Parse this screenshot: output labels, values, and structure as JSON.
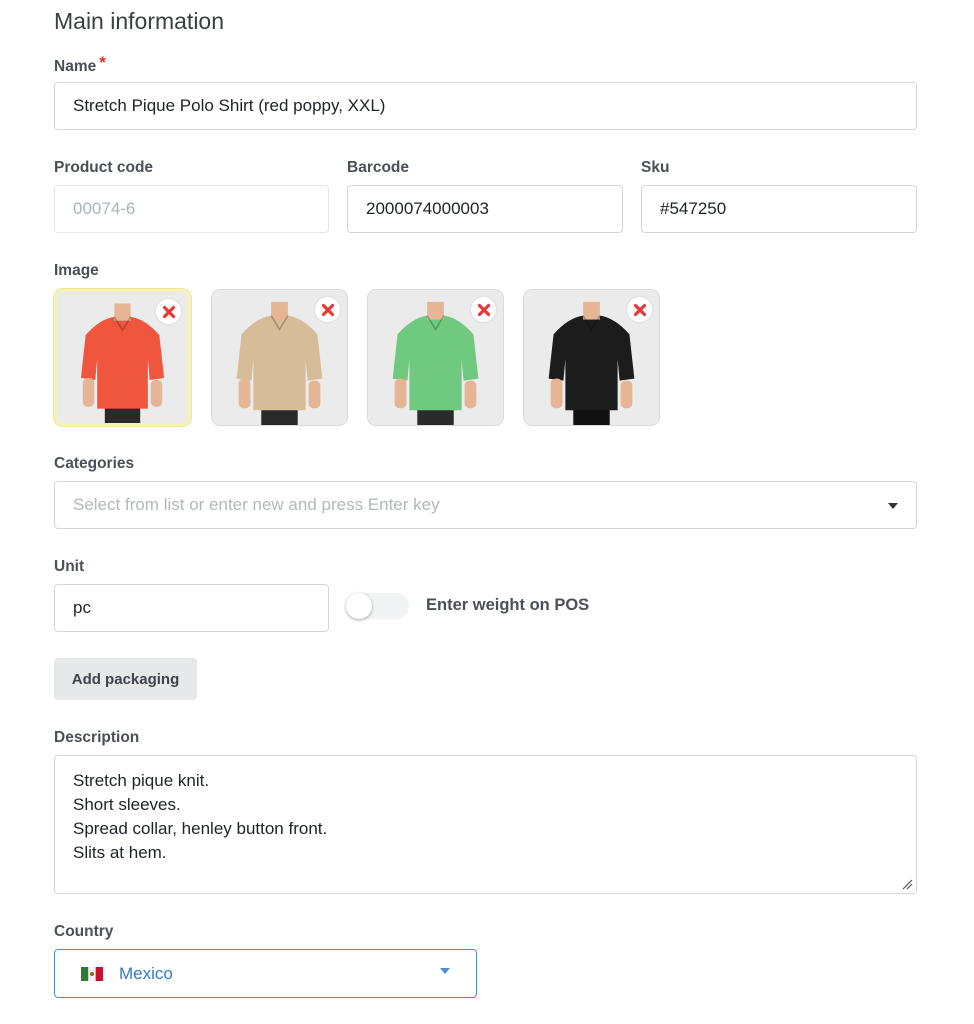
{
  "section": {
    "title": "Main information"
  },
  "name": {
    "label": "Name",
    "required_mark": "*",
    "value": "Stretch Pique Polo Shirt (red poppy, XXL)"
  },
  "product_code": {
    "label": "Product code",
    "value": "00074-6"
  },
  "barcode": {
    "label": "Barcode",
    "value": "2000074000003"
  },
  "sku": {
    "label": "Sku",
    "value": "#547250"
  },
  "image": {
    "label": "Image",
    "items": [
      {
        "color": "red",
        "shirt_hex": "#f0563e",
        "selected": true
      },
      {
        "color": "beige",
        "shirt_hex": "#d6bd98",
        "selected": false
      },
      {
        "color": "green",
        "shirt_hex": "#6fc97e",
        "selected": false
      },
      {
        "color": "black",
        "shirt_hex": "#1c1c1c",
        "selected": false
      }
    ]
  },
  "categories": {
    "label": "Categories",
    "placeholder": "Select from list or enter new and press Enter key"
  },
  "unit": {
    "label": "Unit",
    "value": "pc"
  },
  "weight_toggle": {
    "label": "Enter weight on POS",
    "on": false
  },
  "packaging": {
    "button_label": "Add packaging"
  },
  "description": {
    "label": "Description",
    "lines": [
      "Stretch pique knit.",
      "Short sleeves.",
      "Spread collar, henley button front.",
      "Slits at hem."
    ]
  },
  "country": {
    "label": "Country",
    "value": "Mexico",
    "flag": "mexico-flag-icon"
  },
  "colors": {
    "accent": "#4a8fd6",
    "required": "#e0312b",
    "remove_icon": "#e53935"
  }
}
